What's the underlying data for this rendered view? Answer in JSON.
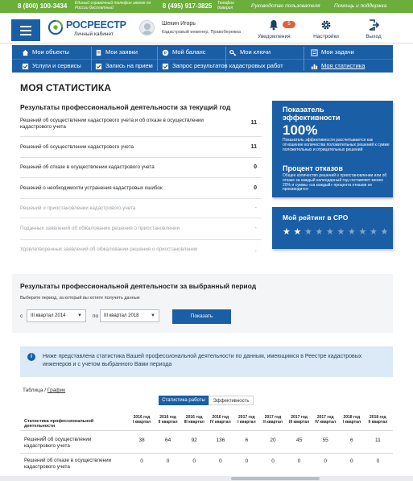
{
  "topbar": {
    "phone1": "8 (800) 100-3434",
    "phone1_note": "Единый справочный телефон звонок по России бесплатный",
    "phone2": "8 (495) 917-3825",
    "phone2_note": "Телефон доверия",
    "guide": "Руководство пользователя",
    "help": "Помощь и поддержка"
  },
  "header": {
    "logo_title": "РОСРЕЕСТР",
    "logo_sub": "Личный кабинет",
    "user_name": "Шекин Игорь",
    "user_role": "Кадастровый инженер, Правобережка",
    "notifications_label": "Уведомления",
    "notifications_count": "5",
    "settings_label": "Настройки",
    "exit_label": "Выход"
  },
  "nav": {
    "my_objects": "Мои объекты",
    "my_requests": "Мои заявки",
    "my_balance": "Мой баланс",
    "my_keys": "Мои ключи",
    "my_tasks": "Мои задачи",
    "services": "Услуги и сервисы",
    "appointment": "Запись на прием",
    "cadastral_results": "Запрос результатов кадастровых работ",
    "my_stats": "Моя статистика"
  },
  "page": {
    "title": "МОЯ СТАТИСТИКА",
    "current_title": "Результаты профессиональной деятельности за текущий год"
  },
  "current_stats": [
    {
      "label": "Решений об осуществлении кадастрового учета и об отказе в осуществлении кадастрового учета",
      "value": "11",
      "muted": false
    },
    {
      "label": "Решений об осуществлении кадастрового учета",
      "value": "11",
      "muted": false
    },
    {
      "label": "Решений об отказе в осуществлении кадастрового учета",
      "value": "0",
      "muted": false
    },
    {
      "label": "Решений о необходимости устранения кадастровых ошибок",
      "value": "0",
      "muted": false
    },
    {
      "label": "Решений о приостановлении кадастрового учета",
      "value": "-",
      "muted": true
    },
    {
      "label": "Поданных заявлений об обжаловании решения о приостановлении",
      "value": "-",
      "muted": true
    },
    {
      "label": "Удовлетворенных заявлений об обжаловании решения о приостановлении",
      "value": "-",
      "muted": true
    }
  ],
  "efficiency_card": {
    "title": "Показатель эффективности",
    "value": "100%",
    "desc": "Показатель эффективности рассчитывается как отношение количества положительных решений к сумме положительных и отрицательных решений",
    "refusals_title": "Процент отказов",
    "refusals_desc": "Общее количество решений о приостановлении или об отказе за каждый календарный год составляет менее 20% и суммы «за каждый» процента отказов не производится"
  },
  "rating_card": {
    "title": "Мой рейтинг в СРО",
    "stars_filled": 2,
    "stars_total": 10
  },
  "period": {
    "title": "Результаты профессиональной деятельности за выбранный период",
    "hint": "Выберите период, за который вы хотите получить данные",
    "from_label": "с",
    "from_value": "III квартал 2014",
    "to_label": "по",
    "to_value": "III квартал 2018",
    "show_button": "Показать"
  },
  "info": {
    "text": "Ниже представлена статистика Вашей профессиональной деятельности по данным, имеющимся в Реестре кадастровых инженеров и с учетом выбранного Вами периода"
  },
  "view_toggle": {
    "table": "Таблица",
    "separator": " / ",
    "chart": "График"
  },
  "tabs": {
    "work_stats": "Статистика работы",
    "efficiency": "Эффективность"
  },
  "table": {
    "header_label": "Статистика профессиональной деятельности",
    "columns": [
      {
        "year": "2016 год",
        "q": "I квартал"
      },
      {
        "year": "2016 год",
        "q": "II квартал"
      },
      {
        "year": "2016 год",
        "q": "III квартал"
      },
      {
        "year": "2016 год",
        "q": "IV квартал"
      },
      {
        "year": "2017 год",
        "q": "I квартал"
      },
      {
        "year": "2017 год",
        "q": "II квартал"
      },
      {
        "year": "2017 год",
        "q": "III квартал"
      },
      {
        "year": "2017 год",
        "q": "IV квартал"
      },
      {
        "year": "2018 год",
        "q": "I квартал"
      },
      {
        "year": "2018 год",
        "q": "II квартал"
      }
    ],
    "rows": [
      {
        "label": "РешениЙ об осуществлении кадастрового учета",
        "values": [
          "38",
          "64",
          "92",
          "136",
          "6",
          "20",
          "45",
          "55",
          "6",
          "11"
        ]
      },
      {
        "label": "Решений об отказе в осуществлении кадастрового учета",
        "values": [
          "0",
          "0",
          "0",
          "0",
          "0",
          "0",
          "0",
          "0",
          "0",
          "0"
        ]
      }
    ]
  },
  "colors": {
    "brand_blue": "#1a5ea6",
    "top_green": "#6cae3b",
    "badge_orange": "#e0623a",
    "star_white": "#ffffff",
    "star_gray": "#7fa6cf"
  }
}
